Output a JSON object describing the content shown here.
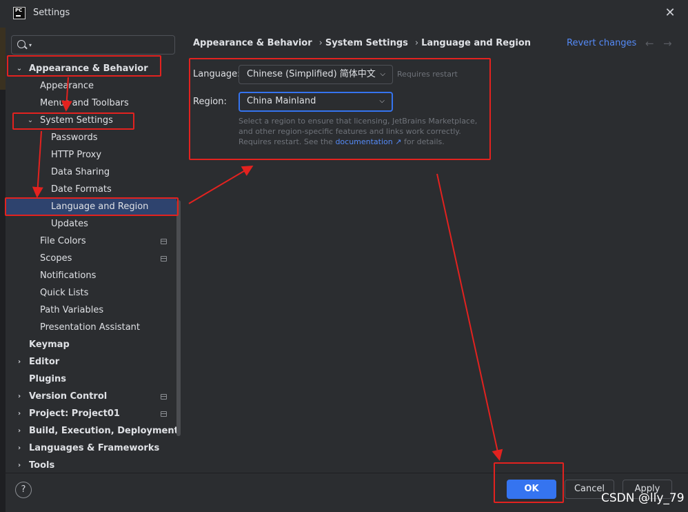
{
  "window": {
    "title": "Settings",
    "logo": "PC"
  },
  "search": {
    "placeholder": ""
  },
  "sidebar": {
    "items": [
      {
        "label": "Appearance & Behavior",
        "level": 0,
        "expanded": true,
        "bold": true
      },
      {
        "label": "Appearance",
        "level": 1
      },
      {
        "label": "Menus and Toolbars",
        "level": 1
      },
      {
        "label": "System Settings",
        "level": 1,
        "expanded": true
      },
      {
        "label": "Passwords",
        "level": 2
      },
      {
        "label": "HTTP Proxy",
        "level": 2
      },
      {
        "label": "Data Sharing",
        "level": 2
      },
      {
        "label": "Date Formats",
        "level": 2
      },
      {
        "label": "Language and Region",
        "level": 2,
        "selected": true
      },
      {
        "label": "Updates",
        "level": 2
      },
      {
        "label": "File Colors",
        "level": 1,
        "pinned": true
      },
      {
        "label": "Scopes",
        "level": 1,
        "pinned": true
      },
      {
        "label": "Notifications",
        "level": 1
      },
      {
        "label": "Quick Lists",
        "level": 1
      },
      {
        "label": "Path Variables",
        "level": 1
      },
      {
        "label": "Presentation Assistant",
        "level": 1
      },
      {
        "label": "Keymap",
        "level": 0,
        "bold": true
      },
      {
        "label": "Editor",
        "level": 0,
        "collapsed": true,
        "bold": true
      },
      {
        "label": "Plugins",
        "level": 0,
        "bold": true
      },
      {
        "label": "Version Control",
        "level": 0,
        "collapsed": true,
        "bold": true,
        "pinned": true
      },
      {
        "label": "Project: Project01",
        "level": 0,
        "collapsed": true,
        "bold": true,
        "pinned": true
      },
      {
        "label": "Build, Execution, Deployment",
        "level": 0,
        "collapsed": true,
        "bold": true
      },
      {
        "label": "Languages & Frameworks",
        "level": 0,
        "collapsed": true,
        "bold": true
      },
      {
        "label": "Tools",
        "level": 0,
        "collapsed": true,
        "bold": true
      }
    ]
  },
  "breadcrumb": [
    "Appearance & Behavior",
    "System Settings",
    "Language and Region"
  ],
  "header": {
    "revert_label": "Revert changes"
  },
  "form": {
    "language_label": "Language:",
    "language_value": "Chinese (Simplified) 简体中文",
    "language_hint": "Requires restart",
    "region_label": "Region:",
    "region_value": "China Mainland",
    "desc_before": "Select a region to ensure that licensing, JetBrains Marketplace, and other region-specific features and links work correctly. Requires restart. See the ",
    "desc_link": "documentation ↗",
    "desc_after": " for details."
  },
  "footer": {
    "ok_label": "OK",
    "cancel_label": "Cancel",
    "apply_label": "Apply",
    "help_label": "?"
  },
  "watermark": "CSDN @lly_79",
  "colors": {
    "background": "#2b2d30",
    "selection": "#2e436e",
    "accent": "#3574f0",
    "link": "#548af7",
    "annotation": "#e3221f"
  }
}
